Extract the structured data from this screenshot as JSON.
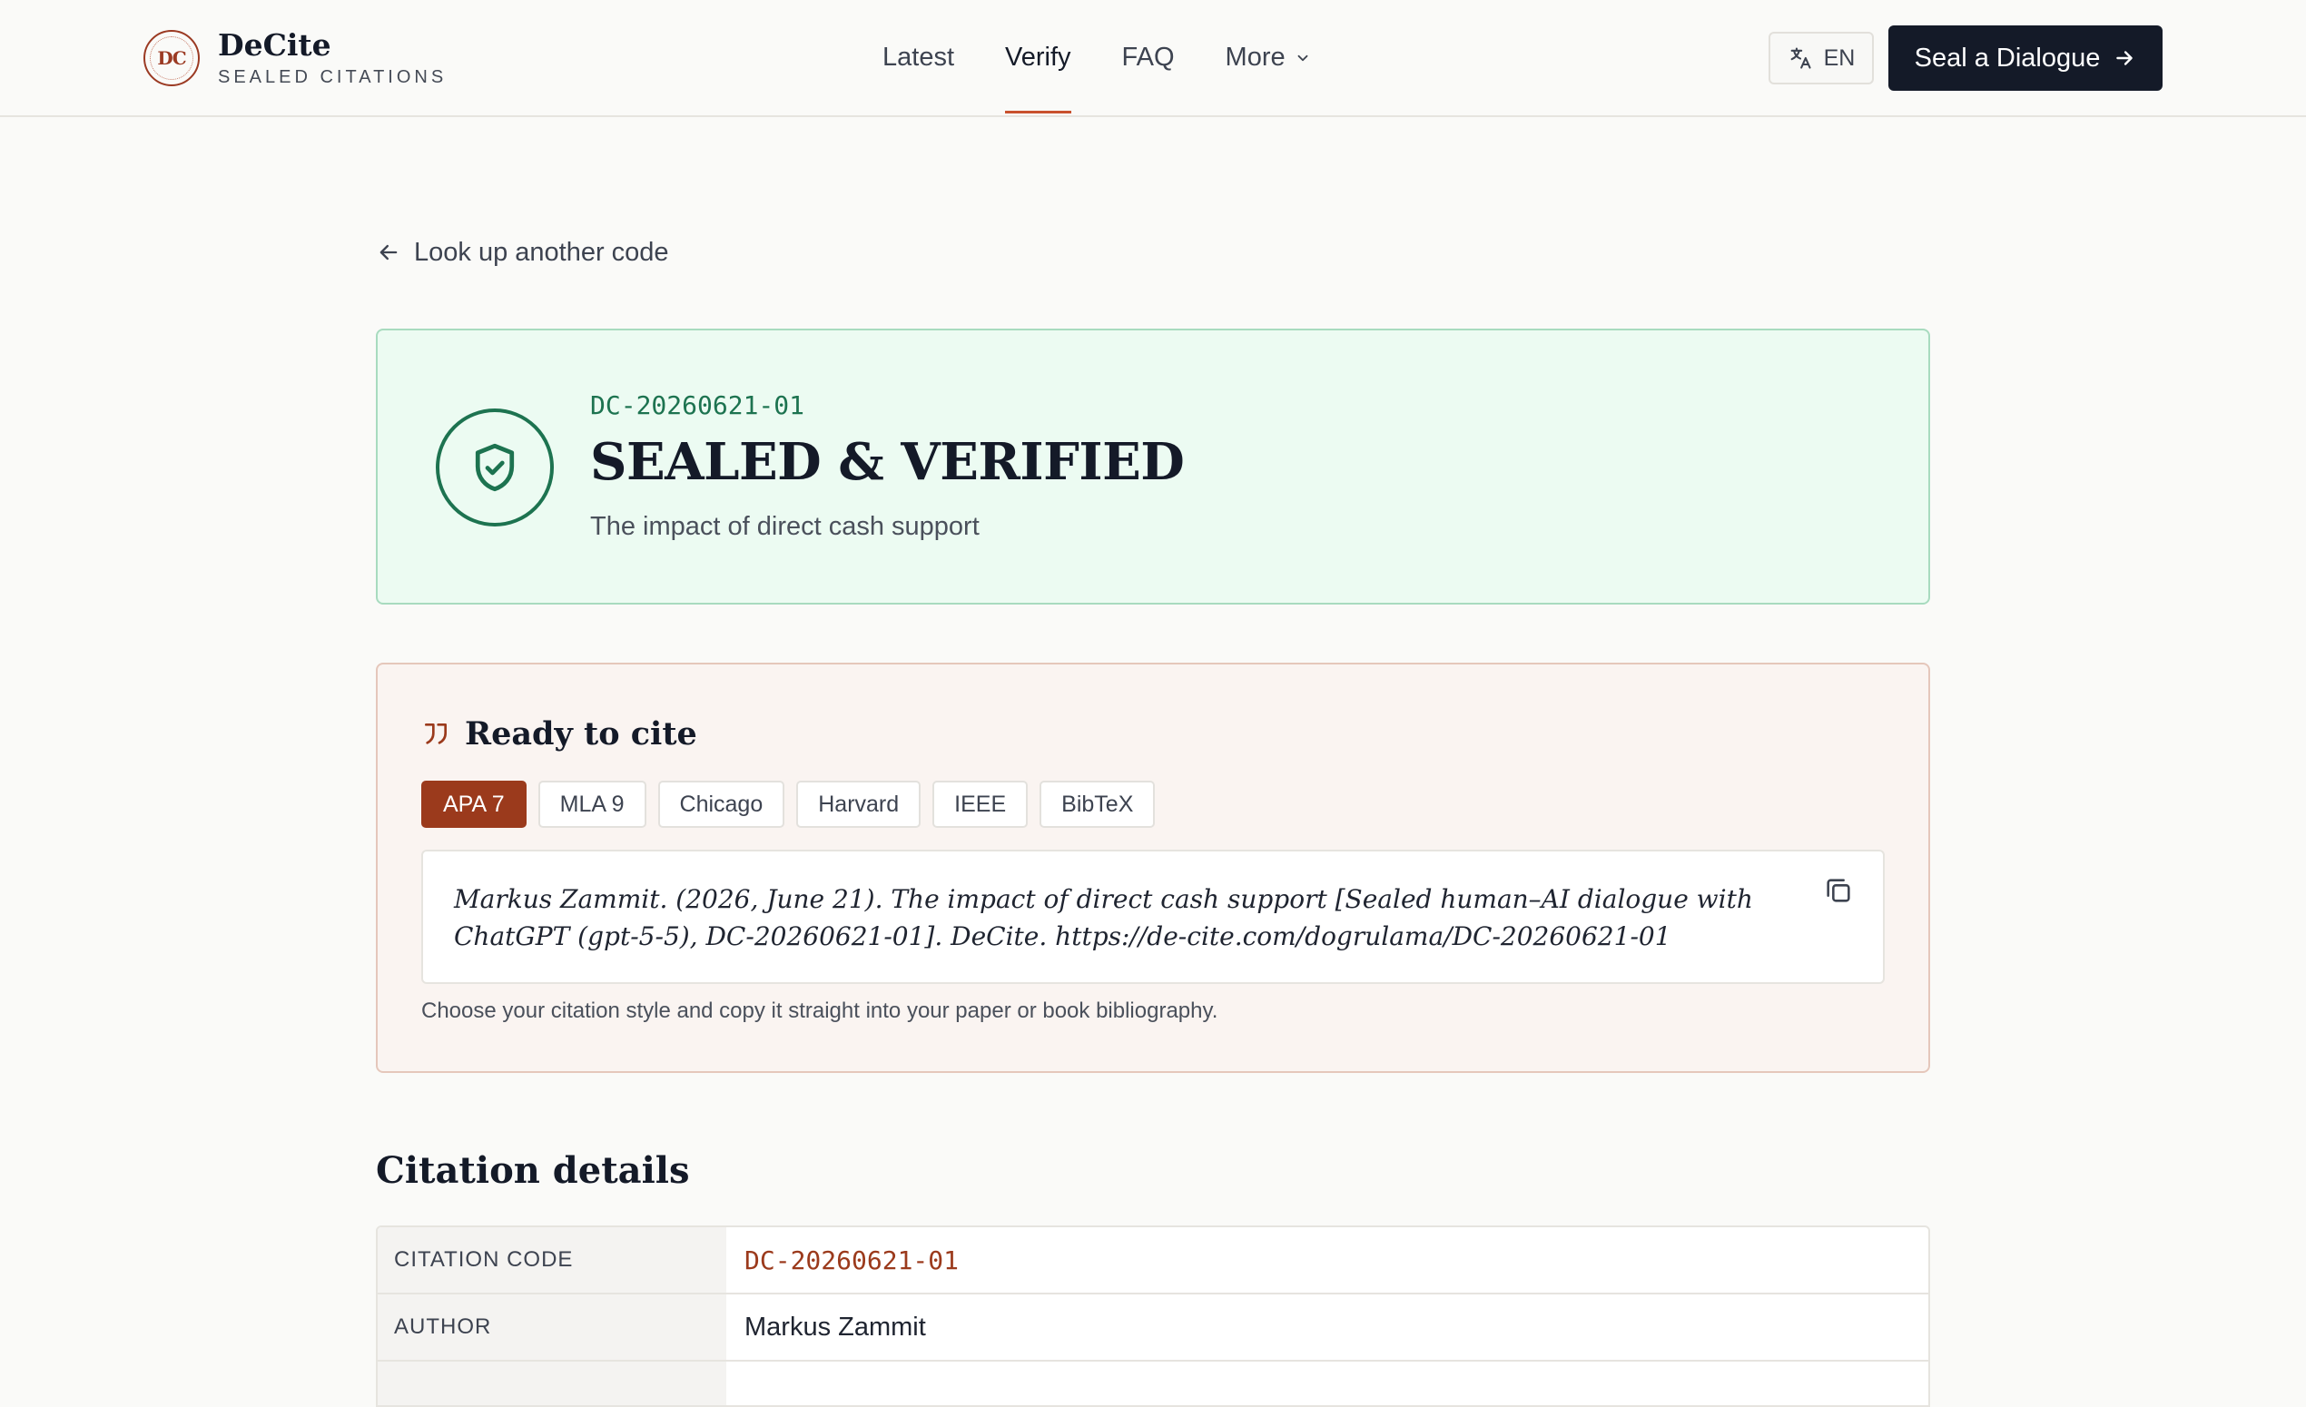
{
  "header": {
    "logo_monogram": "DC",
    "logo_title": "DeCite",
    "logo_subtitle": "SEALED CITATIONS",
    "nav": [
      {
        "label": "Latest",
        "active": false
      },
      {
        "label": "Verify",
        "active": true
      },
      {
        "label": "FAQ",
        "active": false
      },
      {
        "label": "More",
        "active": false
      }
    ],
    "language": "EN",
    "cta_label": "Seal a Dialogue"
  },
  "back_link": "Look up another code",
  "verified": {
    "code": "DC-20260621-01",
    "title": "SEALED & VERIFIED",
    "subtitle": "The impact of direct cash support"
  },
  "cite": {
    "heading": "Ready to cite",
    "styles": [
      "APA 7",
      "MLA 9",
      "Chicago",
      "Harvard",
      "IEEE",
      "BibTeX"
    ],
    "active_style": "APA 7",
    "citation_text": "Markus Zammit. (2026, June 21). The impact of direct cash support [Sealed human–AI dialogue with ChatGPT (gpt-5-5), DC-20260621-01]. DeCite. https://de-cite.com/dogrulama/DC-20260621-01",
    "note": "Choose your citation style and copy it straight into your paper or book bibliography."
  },
  "details": {
    "title": "Citation details",
    "rows": [
      {
        "label": "CITATION CODE",
        "value": "DC-20260621-01"
      },
      {
        "label": "AUTHOR",
        "value": "Markus Zammit"
      },
      {
        "label": "",
        "value": ""
      }
    ]
  },
  "colors": {
    "accent": "#9b3a1c",
    "success": "#1d7350",
    "dark": "#141a28"
  }
}
